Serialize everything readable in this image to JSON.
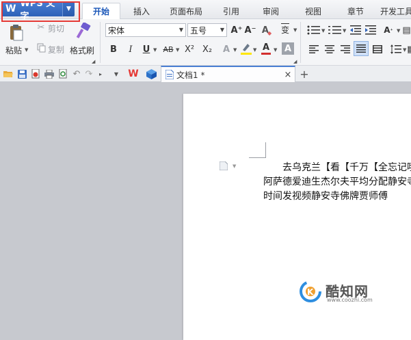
{
  "app": {
    "menu_label": "WPS 文字",
    "menu_logo": "W"
  },
  "tabs": [
    {
      "label": "开始",
      "active": true
    },
    {
      "label": "插入"
    },
    {
      "label": "页面布局"
    },
    {
      "label": "引用"
    },
    {
      "label": "审阅"
    },
    {
      "label": "视图"
    },
    {
      "label": "章节"
    },
    {
      "label": "开发工具"
    }
  ],
  "ribbon": {
    "paste": "粘贴",
    "cut": "剪切",
    "copy": "复制",
    "format_painter": "格式刷",
    "font_name": "宋体",
    "font_size": "五号",
    "bold": "B",
    "italic": "I",
    "underline": "U",
    "strike": "AB",
    "superscript": "X²",
    "subscript": "X₂",
    "font_color": "A",
    "grow_font": "A⁺",
    "shrink_font": "A⁻",
    "clear": "A",
    "pinyin": "变",
    "char_shade": "A",
    "text_effect": "A"
  },
  "doc_tab": {
    "title": "文档1 *",
    "close": "×",
    "add": "+"
  },
  "document": {
    "lines": [
      "去乌克兰【看【千万【全忘记哦",
      "阿萨德爱迪生杰尔夫平均分配静安寺",
      "时间发视频静安寺佛牌贾师傅"
    ]
  },
  "watermark": {
    "name": "酷知网",
    "url": "www.coozhi.com"
  },
  "colors": {
    "accent": "#2e62b8",
    "highlight_box": "#e53935",
    "font_color": "#d32f2f",
    "highlight_yellow": "#ffe600"
  }
}
